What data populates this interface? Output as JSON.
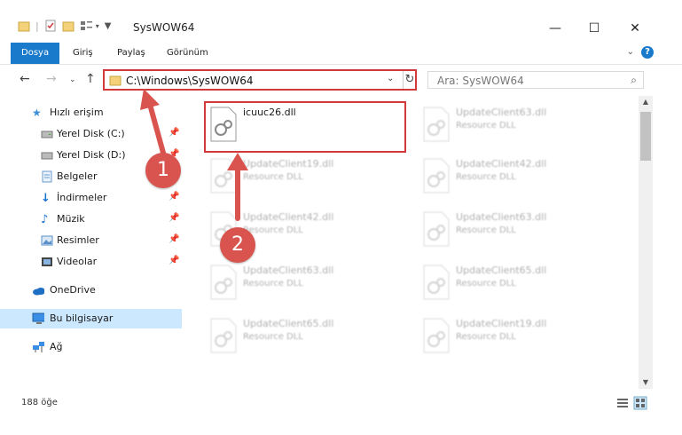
{
  "window": {
    "title": "SysWOW64",
    "minimize_label": "—",
    "maximize_label": "☐",
    "close_label": "✕"
  },
  "ribbon": {
    "tabs": [
      "Dosya",
      "Giriş",
      "Paylaş",
      "Görünüm"
    ],
    "active_tab": "Dosya",
    "help_label": "?"
  },
  "address": {
    "path": "C:\\Windows\\SysWOW64",
    "search_placeholder": "Ara: SysWOW64"
  },
  "sidebar": {
    "items": [
      {
        "label": "Hızlı erişim",
        "icon": "star-icon"
      },
      {
        "label": "Yerel Disk (C:)",
        "icon": "drive-icon",
        "pinned": true
      },
      {
        "label": "Yerel Disk (D:)",
        "icon": "drive-icon",
        "pinned": true
      },
      {
        "label": "Belgeler",
        "icon": "documents-icon",
        "pinned": true
      },
      {
        "label": "İndirmeler",
        "icon": "download-icon",
        "pinned": true
      },
      {
        "label": "Müzik",
        "icon": "music-icon",
        "pinned": true
      },
      {
        "label": "Resimler",
        "icon": "pictures-icon",
        "pinned": true
      },
      {
        "label": "Videolar",
        "icon": "videos-icon",
        "pinned": true
      },
      {
        "label": "OneDrive",
        "icon": "cloud-icon"
      },
      {
        "label": "Bu bilgisayar",
        "icon": "computer-icon",
        "selected": true
      },
      {
        "label": "Ağ",
        "icon": "network-icon"
      }
    ]
  },
  "files": [
    {
      "name": "icuuc26.dll",
      "type": ""
    },
    {
      "name": "UpdateClient63.dll",
      "type": "Resource DLL"
    },
    {
      "name": "UpdateClient19.dll",
      "type": "Resource DLL"
    },
    {
      "name": "UpdateClient42.dll",
      "type": "Resource DLL"
    },
    {
      "name": "UpdateClient42.dll",
      "type": "Resource DLL"
    },
    {
      "name": "UpdateClient63.dll",
      "type": "Resource DLL"
    },
    {
      "name": "UpdateClient63.dll",
      "type": "Resource DLL"
    },
    {
      "name": "UpdateClient65.dll",
      "type": "Resource DLL"
    },
    {
      "name": "UpdateClient65.dll",
      "type": "Resource DLL"
    },
    {
      "name": "UpdateClient19.dll",
      "type": "Resource DLL"
    }
  ],
  "status": {
    "item_count": "188 öğe"
  },
  "annotations": {
    "step1": "1",
    "step2": "2",
    "color": "#d9534f"
  }
}
